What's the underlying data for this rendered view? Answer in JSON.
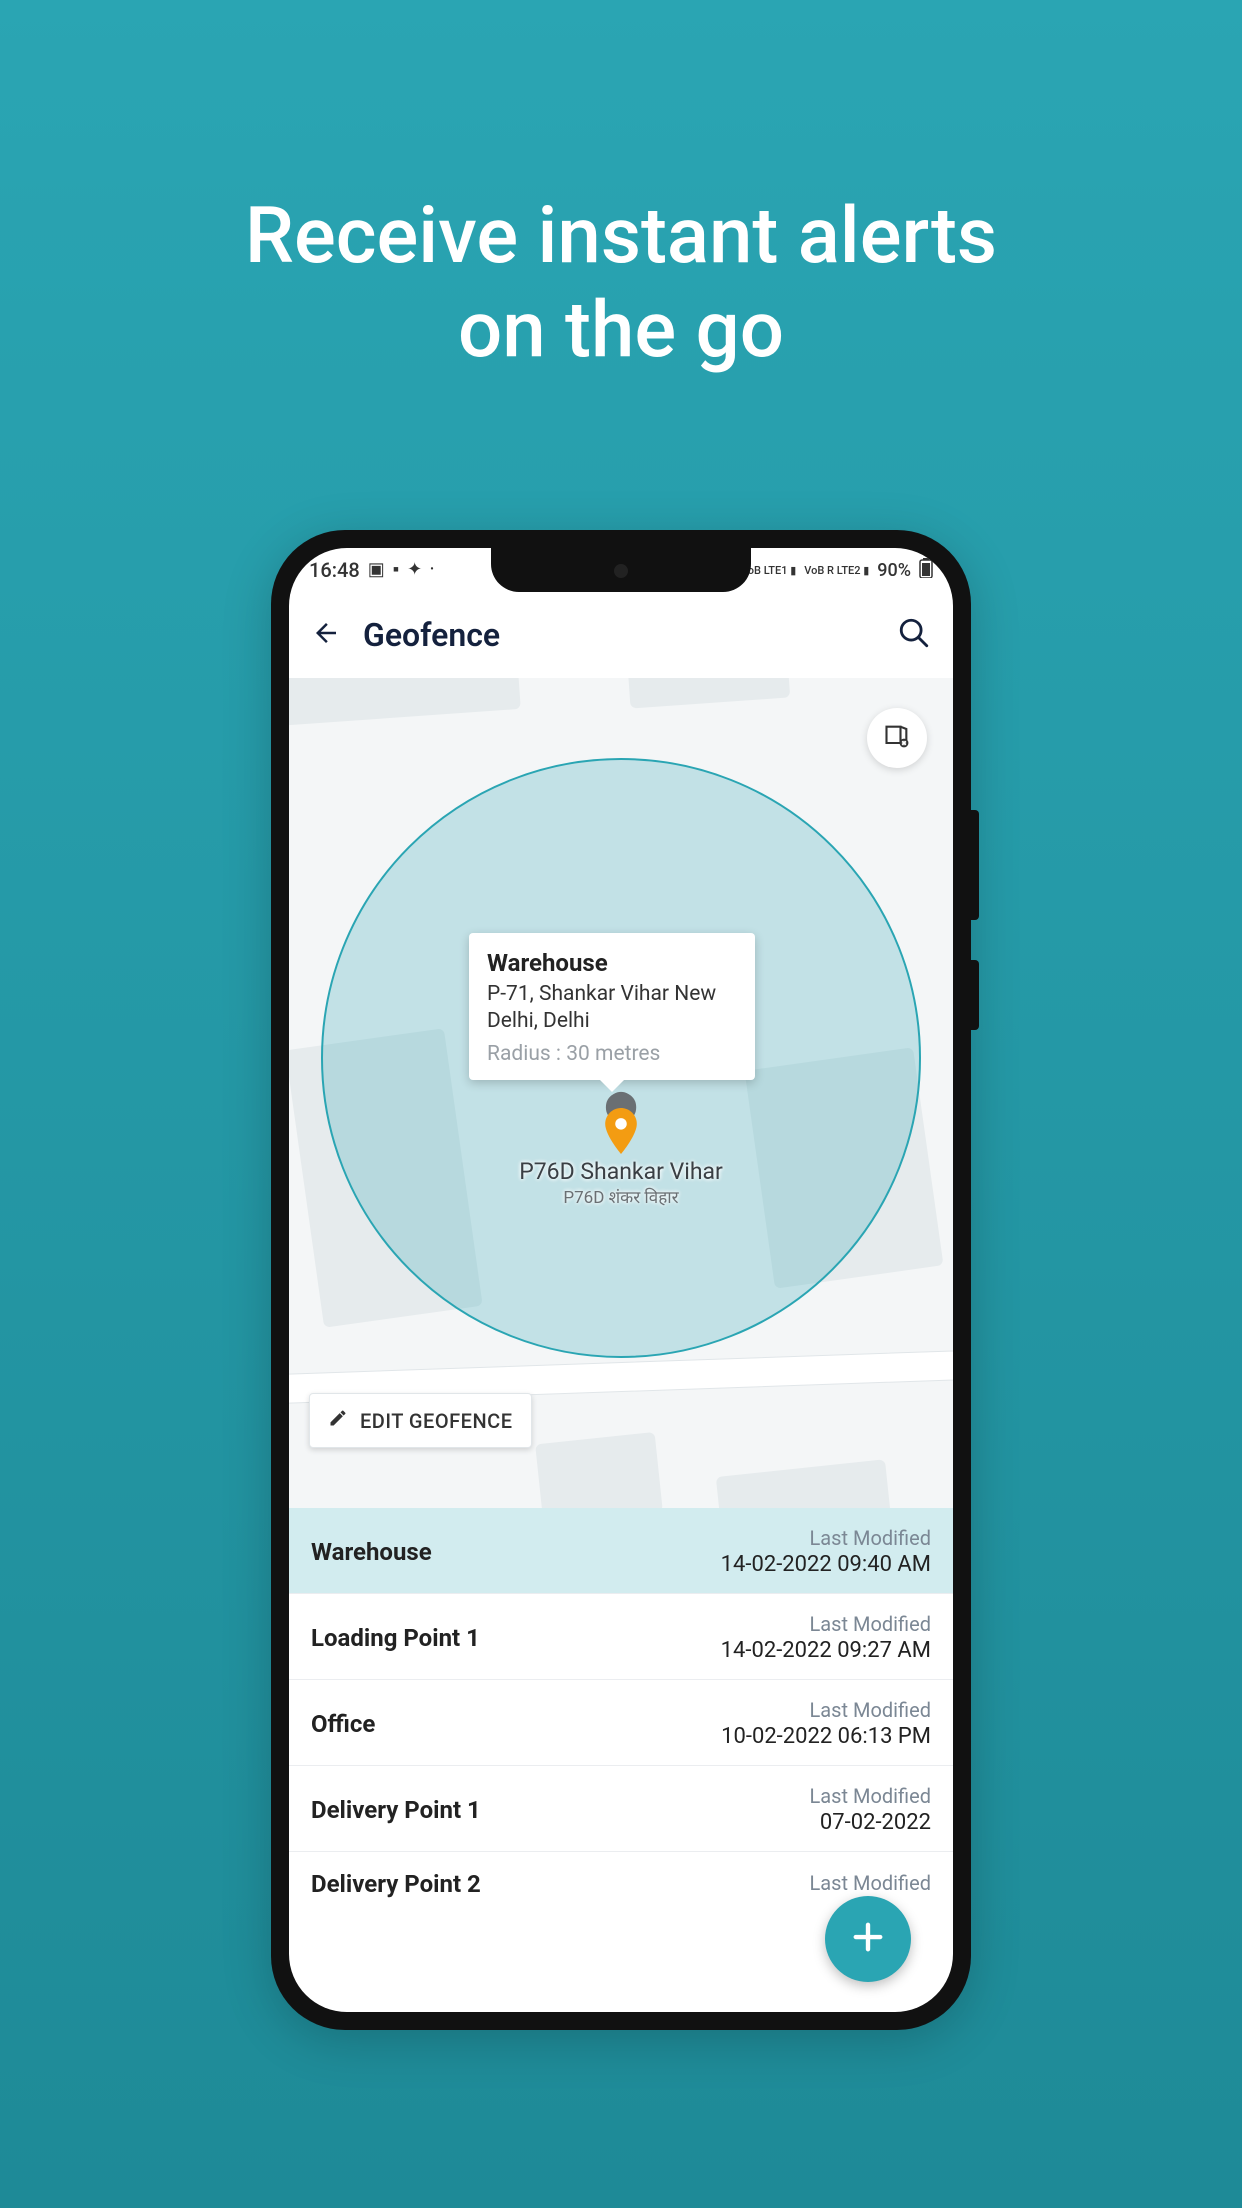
{
  "headline_line1": "Receive instant alerts",
  "headline_line2": "on the go",
  "status": {
    "time": "16:48",
    "battery": "90%"
  },
  "header": {
    "title": "Geofence"
  },
  "infoCard": {
    "title": "Warehouse",
    "address": "P-71, Shankar Vihar New Delhi, Delhi",
    "radius": "Radius : 30 metres"
  },
  "mapPlace": {
    "name": "P76D Shankar Vihar",
    "sub": "P76D शंकर विहार"
  },
  "editButton": "EDIT GEOFENCE",
  "lastModifiedLabel": "Last Modified",
  "list": [
    {
      "name": "Warehouse",
      "date": "14-02-2022  09:40 AM"
    },
    {
      "name": "Loading Point 1",
      "date": "14-02-2022  09:27 AM"
    },
    {
      "name": "Office",
      "date": "10-02-2022  06:13 PM"
    },
    {
      "name": "Delivery Point 1",
      "date": "07-02-2022"
    },
    {
      "name": "Delivery Point 2",
      "date": ""
    }
  ]
}
